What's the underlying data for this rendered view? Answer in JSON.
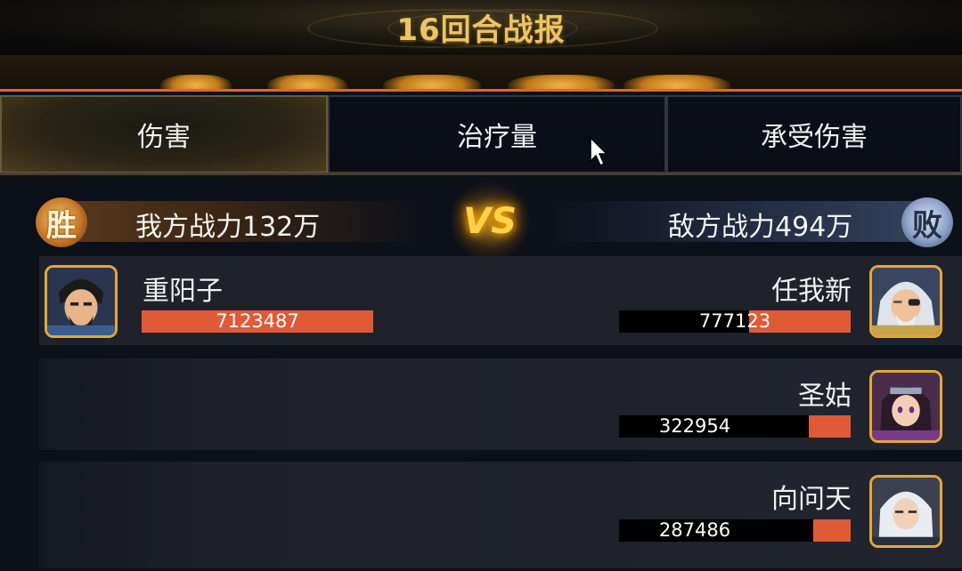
{
  "header": {
    "title": "16回合战报"
  },
  "tabs": [
    {
      "label": "伤害",
      "active": true
    },
    {
      "label": "治疗量",
      "active": false
    },
    {
      "label": "承受伤害",
      "active": false
    }
  ],
  "power": {
    "ally_badge": "胜",
    "ally_text": "我方战力132万",
    "vs_text": "VS",
    "enemy_text": "敌方战力494万",
    "enemy_badge": "败"
  },
  "ally_heroes": [
    {
      "name": "重阳子",
      "value": "7123487",
      "fill_fraction": 1.0
    }
  ],
  "enemy_heroes": [
    {
      "name": "任我新",
      "value": "777123",
      "fill_fraction": 0.44
    },
    {
      "name": "圣姑",
      "value": "322954",
      "fill_fraction": 0.18
    },
    {
      "name": "向问天",
      "value": "287486",
      "fill_fraction": 0.16
    }
  ],
  "colors": {
    "accent_orange": "#e0672a",
    "bar_fill": "#e05a36",
    "title_gold": "#e8c56a",
    "avatar_border": "#e3a83a"
  }
}
